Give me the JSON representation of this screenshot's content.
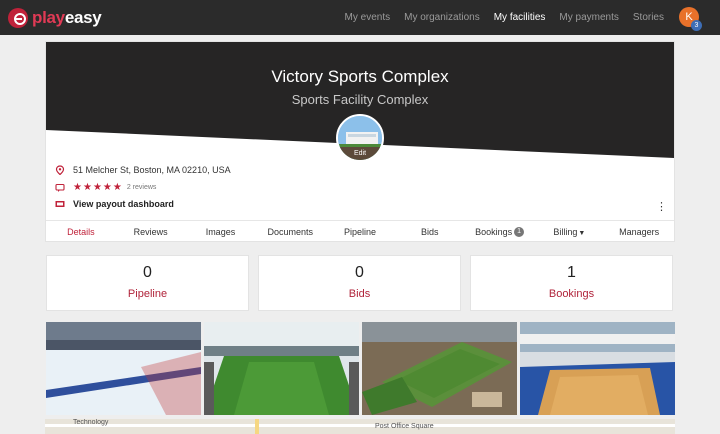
{
  "brand": {
    "play": "play",
    "easy": "easy",
    "accent": "#c0223a"
  },
  "nav": {
    "items": [
      {
        "label": "My events",
        "active": false
      },
      {
        "label": "My organizations",
        "active": false
      },
      {
        "label": "My facilities",
        "active": true
      },
      {
        "label": "My payments",
        "active": false
      },
      {
        "label": "Stories",
        "active": false
      }
    ],
    "avatar_initial": "K",
    "notification_count": "3"
  },
  "facility": {
    "name": "Victory Sports Complex",
    "type": "Sports Facility Complex",
    "edit_label": "Edit",
    "address": "51 Melcher St, Boston, MA 02210, USA",
    "rating": 5,
    "reviews_text": "2 reviews",
    "payout_link": "View payout dashboard"
  },
  "tabs": [
    {
      "label": "Details",
      "active": true
    },
    {
      "label": "Reviews"
    },
    {
      "label": "Images"
    },
    {
      "label": "Documents"
    },
    {
      "label": "Pipeline"
    },
    {
      "label": "Bids"
    },
    {
      "label": "Bookings",
      "badge": "1"
    },
    {
      "label": "Billing",
      "dropdown": true
    },
    {
      "label": "Managers"
    }
  ],
  "stats": [
    {
      "value": "0",
      "label": "Pipeline"
    },
    {
      "value": "0",
      "label": "Bids"
    },
    {
      "value": "1",
      "label": "Bookings"
    }
  ],
  "gallery": [
    "ice-rink-photo",
    "indoor-soccer-field-photo",
    "aerial-fields-photo",
    "basketball-court-photo"
  ],
  "map": {
    "label_1": "Technology",
    "label_2": "Post Office Square"
  }
}
